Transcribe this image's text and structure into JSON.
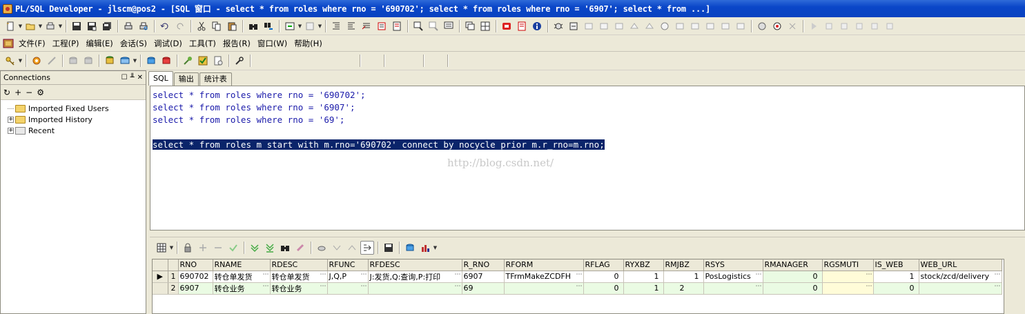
{
  "window": {
    "title": "PL/SQL Developer - jlscm@pos2 - [SQL 窗口 - select * from roles where rno = '690702'; select * from roles where rno = '6907'; select * from ...]"
  },
  "menu": {
    "items": [
      {
        "label": "文件(F)"
      },
      {
        "label": "工程(P)"
      },
      {
        "label": "编辑(E)"
      },
      {
        "label": "会话(S)"
      },
      {
        "label": "调试(D)"
      },
      {
        "label": "工具(T)"
      },
      {
        "label": "报告(R)"
      },
      {
        "label": "窗口(W)"
      },
      {
        "label": "帮助(H)"
      }
    ]
  },
  "connections": {
    "title": "Connections",
    "tree": [
      {
        "label": "Imported Fixed Users",
        "expandable": false
      },
      {
        "label": "Imported History",
        "expandable": true
      },
      {
        "label": "Recent",
        "expandable": true
      }
    ]
  },
  "tabs": [
    {
      "label": "SQL",
      "active": true
    },
    {
      "label": "输出",
      "active": false
    },
    {
      "label": "统计表",
      "active": false
    }
  ],
  "editor": {
    "lines": [
      {
        "text": "select * from roles where rno = '690702';",
        "selected": false
      },
      {
        "text": "select * from roles where rno = '6907';",
        "selected": false
      },
      {
        "text": "select * from roles where rno = '69';",
        "selected": false
      },
      {
        "text": "",
        "selected": false
      },
      {
        "text": "select * from roles m start with m.rno='690702' connect by nocycle prior m.r_rno=m.rno;",
        "selected": true
      }
    ],
    "watermark": "http://blog.csdn.net/"
  },
  "grid": {
    "columns": [
      "RNO",
      "RNAME",
      "RDESC",
      "RFUNC",
      "RFDESC",
      "R_RNO",
      "RFORM",
      "RFLAG",
      "RYXBZ",
      "RMJBZ",
      "RSYS",
      "RMANAGER",
      "RGSMUTI",
      "IS_WEB",
      "WEB_URL"
    ],
    "rows": [
      {
        "num": "1",
        "current": true,
        "cells": [
          "690702",
          "转仓单发货",
          "转仓单发货",
          "J,Q,P",
          "J:发货,Q:查询,P:打印",
          "6907",
          "TFrmMakeZCDFH",
          "0",
          "1",
          "1",
          "PosLogistics",
          "0",
          "",
          "1",
          "stock/zcd/delivery"
        ]
      },
      {
        "num": "2",
        "current": false,
        "cells": [
          "6907",
          "转仓业务",
          "转仓业务",
          "",
          "",
          "69",
          "",
          "0",
          "1",
          "2",
          "",
          "0",
          "",
          "0",
          ""
        ]
      }
    ]
  }
}
